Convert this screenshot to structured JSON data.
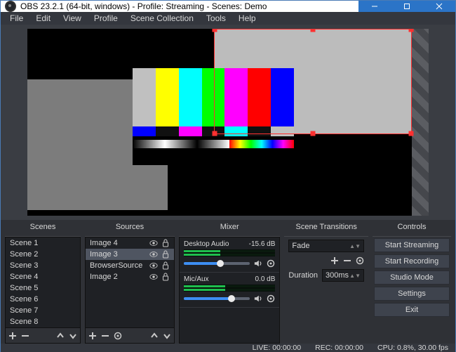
{
  "title": "OBS 23.2.1 (64-bit, windows) - Profile: Streaming - Scenes: Demo",
  "menu": [
    "File",
    "Edit",
    "View",
    "Profile",
    "Scene Collection",
    "Tools",
    "Help"
  ],
  "panels": {
    "scenes": {
      "title": "Scenes",
      "items": [
        "Scene 1",
        "Scene 2",
        "Scene 3",
        "Scene 4",
        "Scene 5",
        "Scene 6",
        "Scene 7",
        "Scene 8"
      ]
    },
    "sources": {
      "title": "Sources",
      "items": [
        {
          "label": "Image 4",
          "selected": false
        },
        {
          "label": "Image 3",
          "selected": true
        },
        {
          "label": "BrowserSource",
          "selected": false
        },
        {
          "label": "Image 2",
          "selected": false
        }
      ]
    },
    "mixer": {
      "title": "Mixer",
      "channels": [
        {
          "name": "Desktop Audio",
          "db": "-15.6 dB",
          "level": 40,
          "slider": 55
        },
        {
          "name": "Mic/Aux",
          "db": "0.0 dB",
          "level": 45,
          "slider": 72
        }
      ]
    },
    "transitions": {
      "title": "Scene Transitions",
      "selected": "Fade",
      "duration_label": "Duration",
      "duration_value": "300ms"
    },
    "controls": {
      "title": "Controls",
      "buttons": [
        "Start Streaming",
        "Start Recording",
        "Studio Mode",
        "Settings",
        "Exit"
      ]
    }
  },
  "status": {
    "live": "LIVE: 00:00:00",
    "rec": "REC: 00:00:00",
    "cpu": "CPU: 0.8%, 30.00 fps"
  },
  "colors": {
    "accent": "#ff3030",
    "panel": "#2f3136"
  }
}
